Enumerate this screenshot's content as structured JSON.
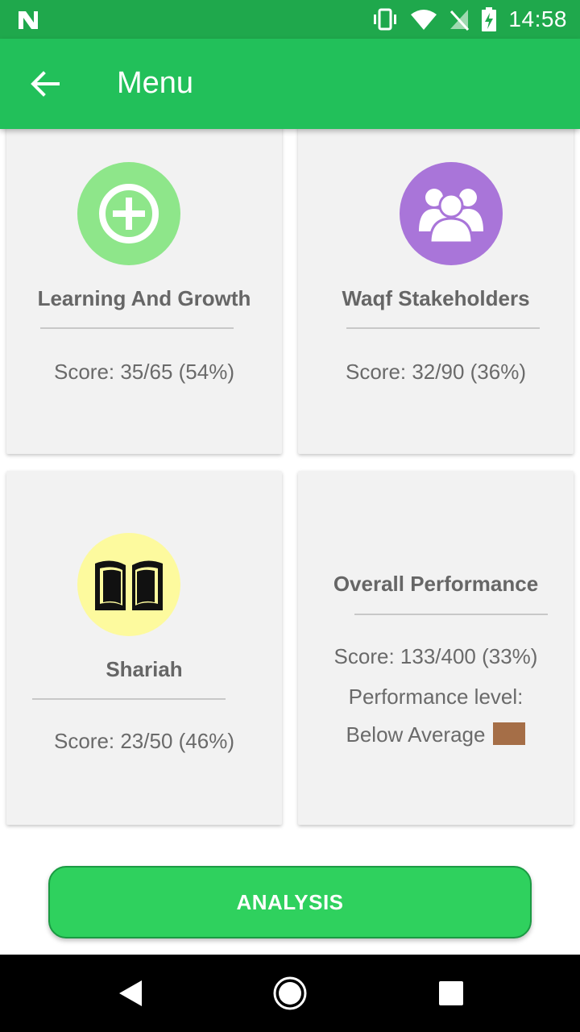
{
  "status_bar": {
    "time": "14:58"
  },
  "app_bar": {
    "title": "Menu"
  },
  "cards": [
    {
      "title": "Learning And Growth",
      "score": "Score: 35/65 (54%)",
      "icon": "plus-circle-icon",
      "icon_bg": "#8ee68a"
    },
    {
      "title": "Waqf Stakeholders",
      "score": "Score: 32/90 (36%)",
      "icon": "group-icon",
      "icon_bg": "#a975d9"
    },
    {
      "title": "Shariah",
      "score": "Score: 23/50 (46%)",
      "icon": "book-icon",
      "icon_bg": "#fdfa9e"
    }
  ],
  "overall": {
    "title": "Overall Performance",
    "score": "Score: 133/400 (33%)",
    "level_label": "Performance level:",
    "level_value": "Below Average",
    "level_color": "#a56e47"
  },
  "analysis_button": {
    "label": "ANALYSIS"
  },
  "colors": {
    "status_bar": "#1fa84c",
    "app_bar": "#22c05a",
    "button": "#2fd15e"
  }
}
